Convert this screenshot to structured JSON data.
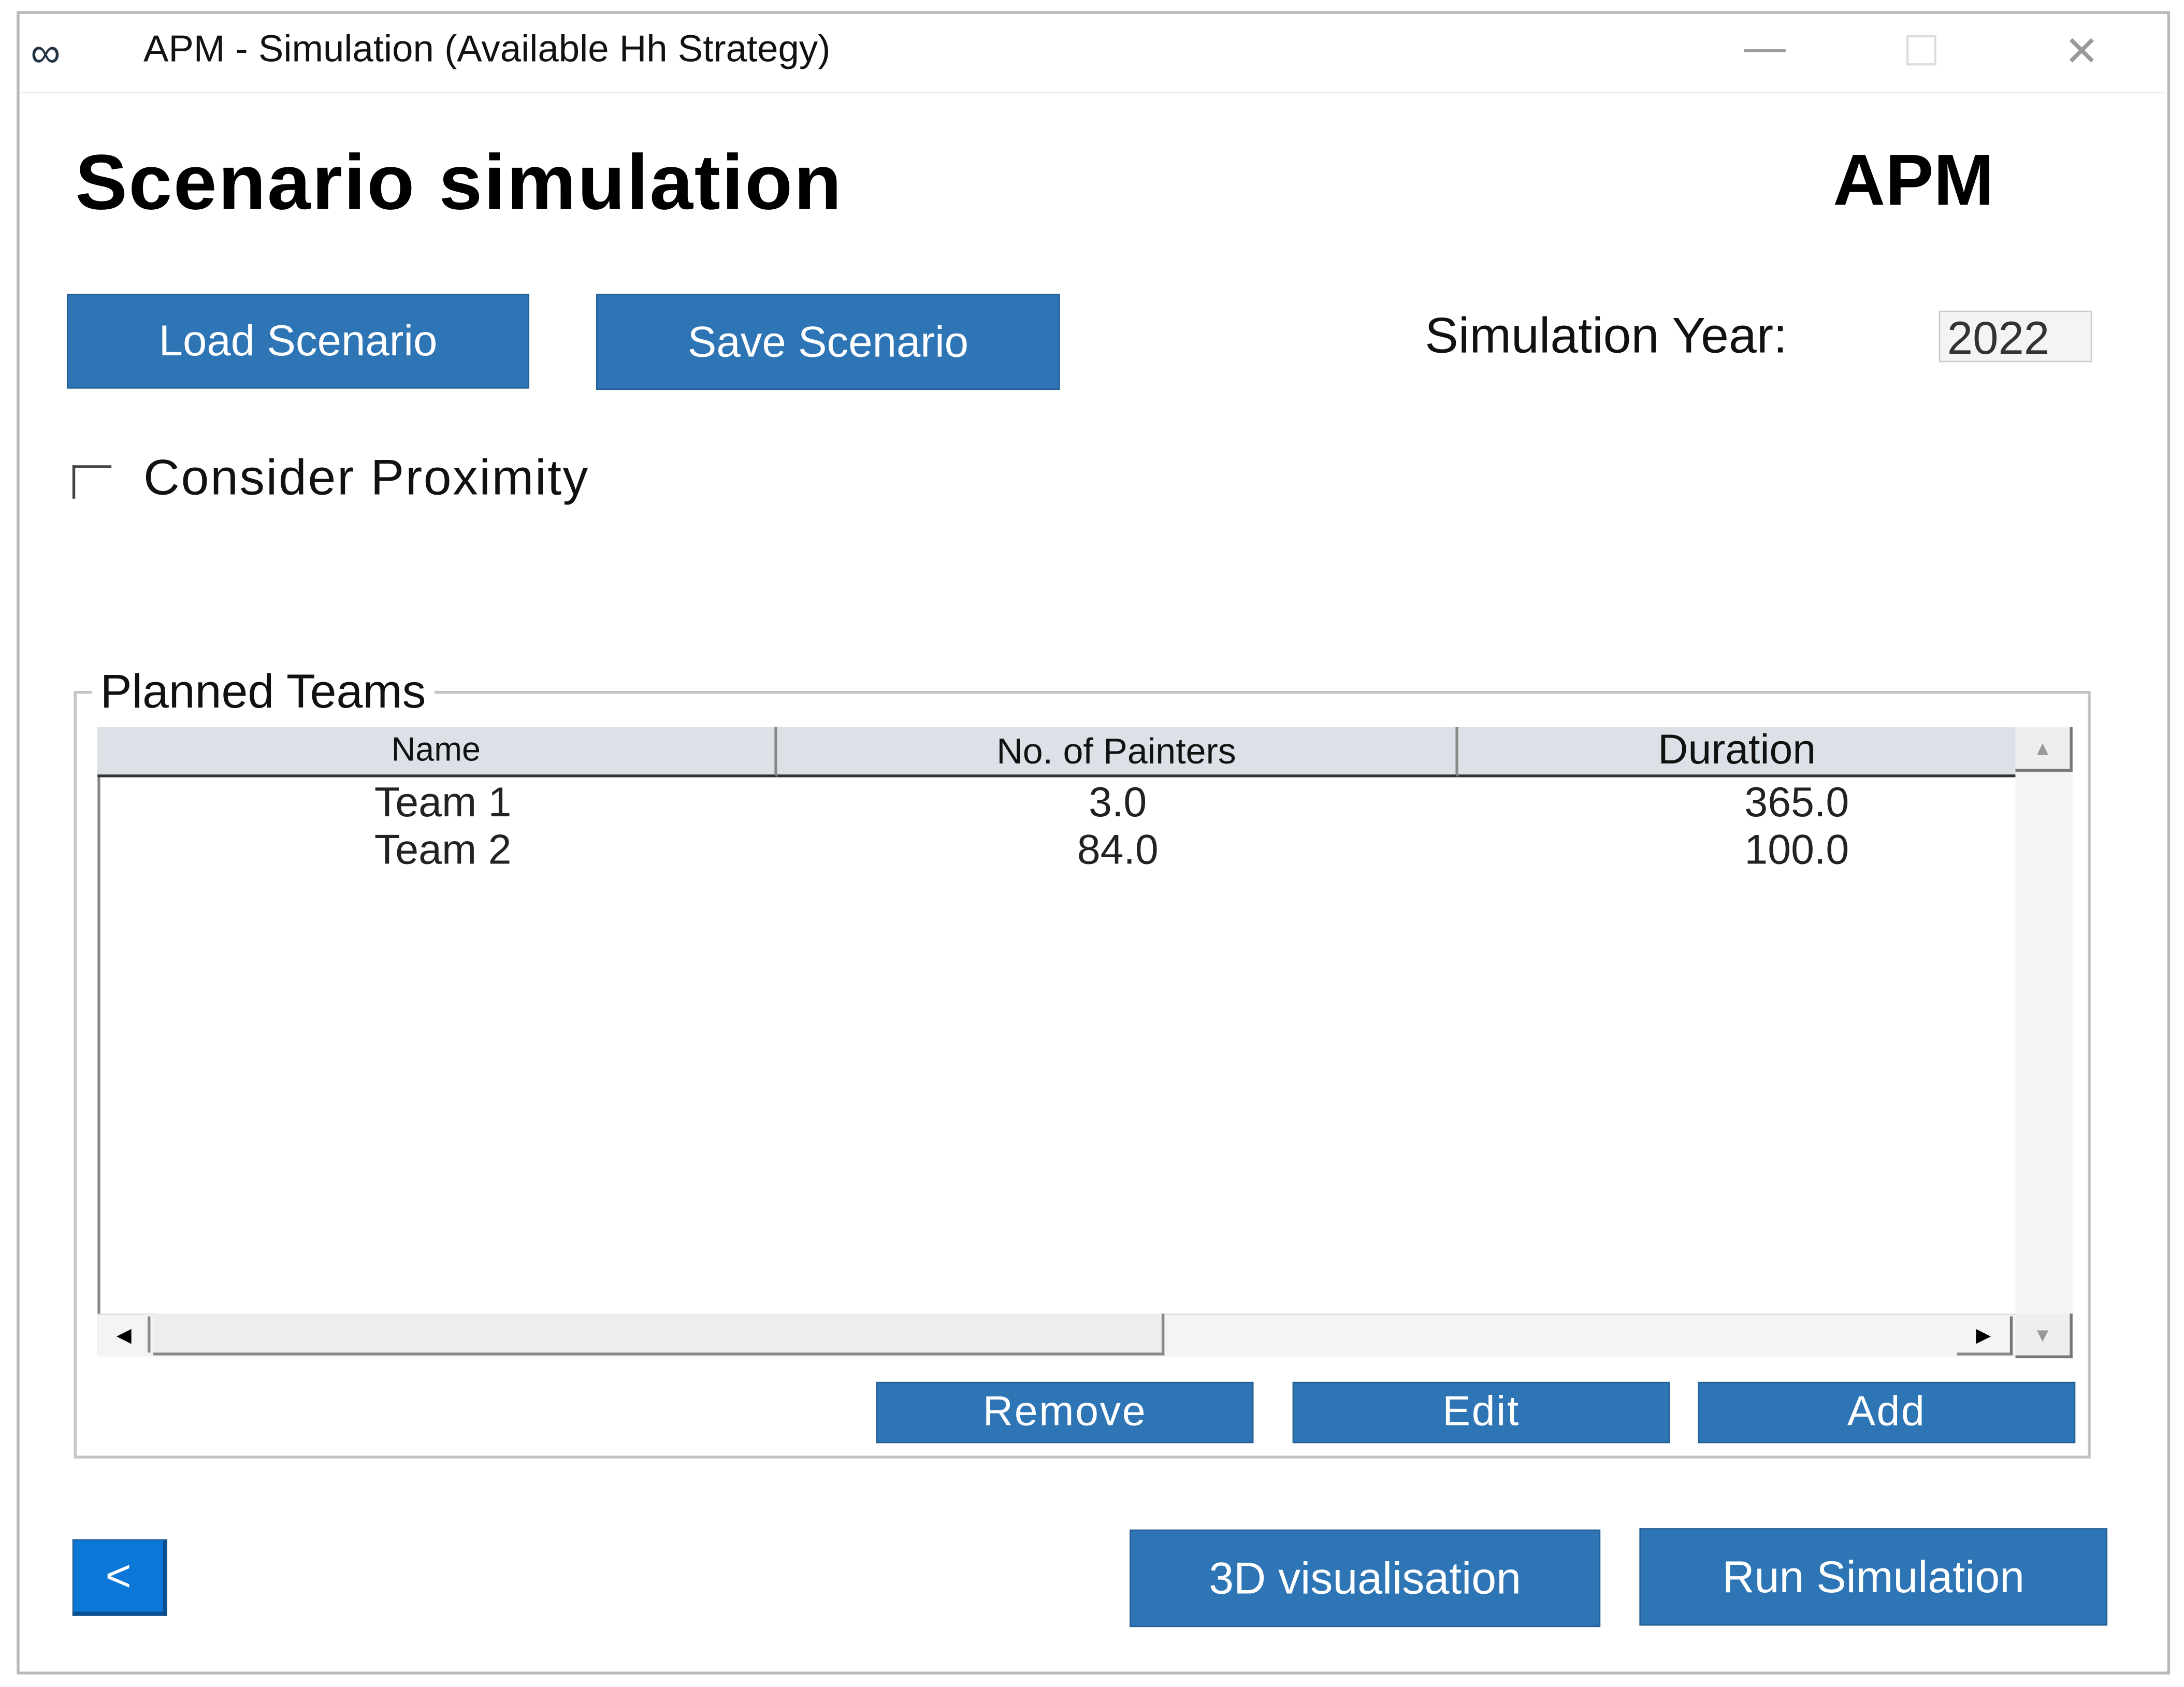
{
  "window": {
    "title": "APM - Simulation (Available Hh Strategy)",
    "app_icon": "infinity-icon",
    "controls": {
      "minimize": "—",
      "maximize": "☐",
      "close": "✕"
    }
  },
  "header": {
    "title": "Scenario simulation",
    "brand": "APM"
  },
  "toolbar": {
    "load_label": "Load Scenario",
    "save_label": "Save Scenario"
  },
  "simulation_year": {
    "label": "Simulation Year:",
    "value": "2022"
  },
  "proximity": {
    "label": "Consider Proximity",
    "checked": false
  },
  "planned_teams": {
    "title": "Planned Teams",
    "columns": [
      "Name",
      "No. of Painters",
      "Duration"
    ],
    "rows": [
      {
        "name": "Team 1",
        "painters": "3.0",
        "duration": "365.0"
      },
      {
        "name": "Team 2",
        "painters": "84.0",
        "duration": "100.0"
      }
    ],
    "remove_label": "Remove",
    "edit_label": "Edit",
    "add_label": "Add"
  },
  "footer": {
    "back_label": "<",
    "visualisation_label": "3D visualisation",
    "run_label": "Run Simulation"
  },
  "colors": {
    "accent": "#2e75b6",
    "header_bg": "#dce1e8"
  }
}
